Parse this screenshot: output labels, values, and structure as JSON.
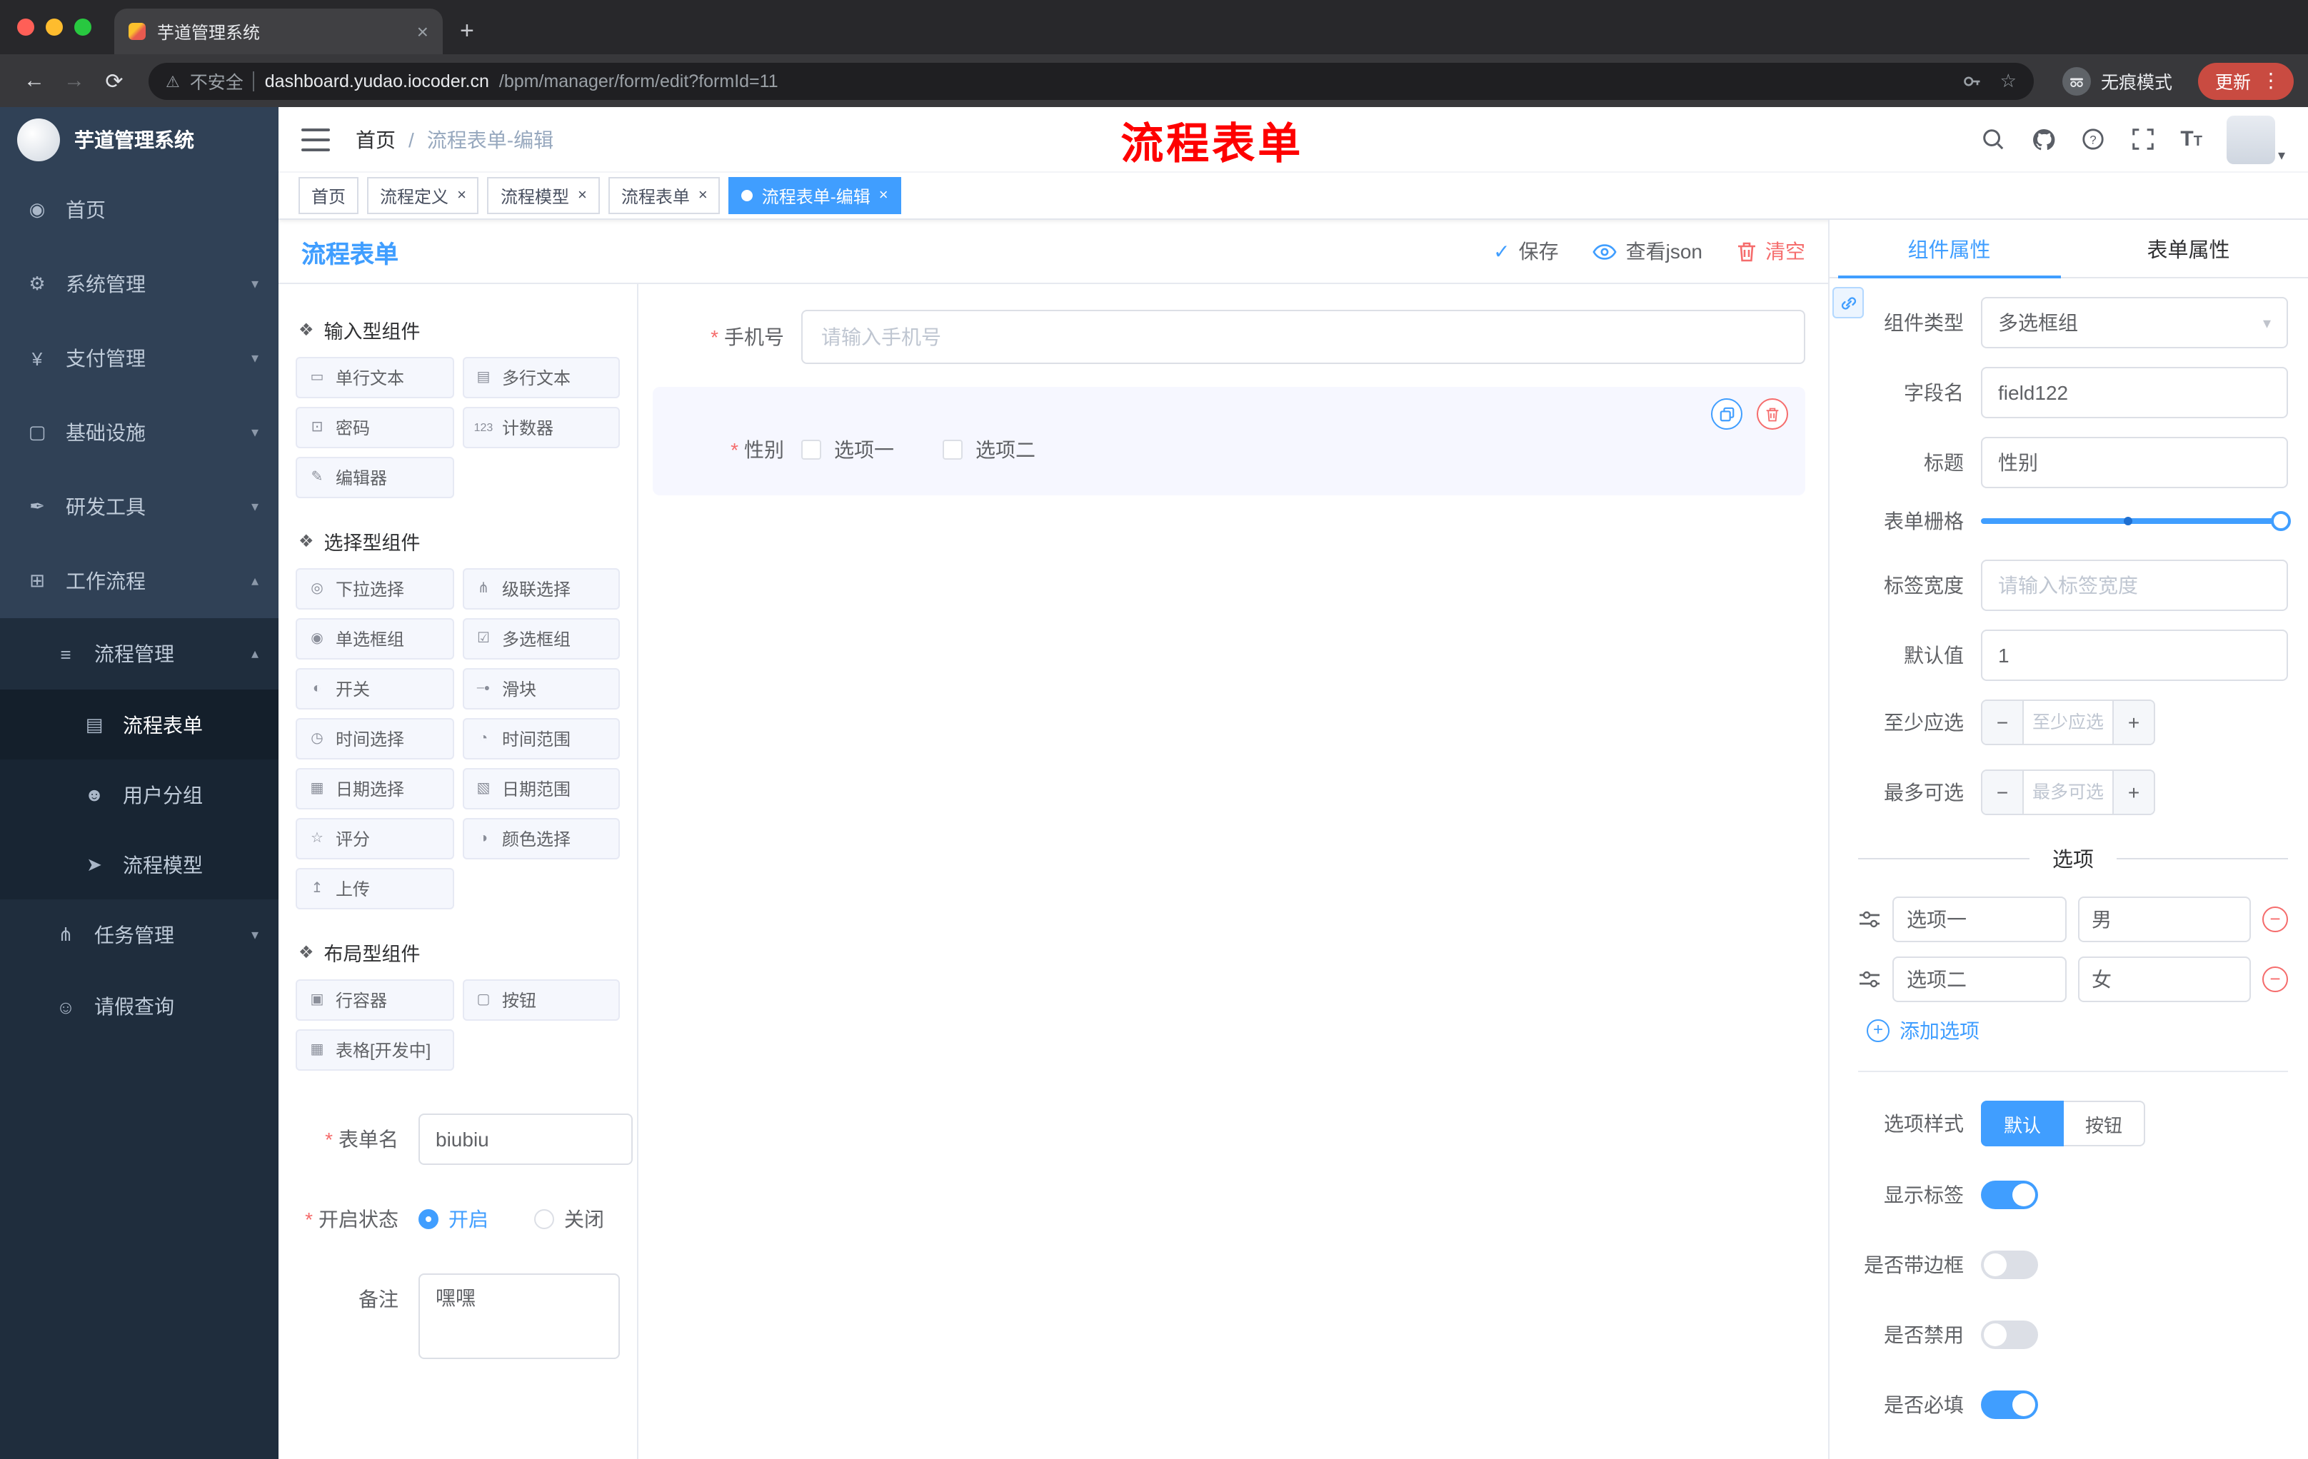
{
  "browser": {
    "tab_title": "芋道管理系统",
    "security_label": "不安全",
    "url_host": "dashboard.yudao.iocoder.cn",
    "url_path": "/bpm/manager/form/edit?formId=11",
    "incognito_label": "无痕模式",
    "update_label": "更新"
  },
  "sidebar": {
    "logo_title": "芋道管理系统",
    "items": [
      {
        "label": "首页",
        "icon": "◉"
      },
      {
        "label": "系统管理",
        "icon": "⚙"
      },
      {
        "label": "支付管理",
        "icon": "¥"
      },
      {
        "label": "基础设施",
        "icon": "▢"
      },
      {
        "label": "研发工具",
        "icon": "✒"
      },
      {
        "label": "工作流程",
        "icon": "⊞"
      },
      {
        "label": "流程管理",
        "icon": "≡"
      },
      {
        "label": "流程表单",
        "icon": "▤"
      },
      {
        "label": "用户分组",
        "icon": "☻"
      },
      {
        "label": "流程模型",
        "icon": "➤"
      },
      {
        "label": "任务管理",
        "icon": "⋔"
      },
      {
        "label": "请假查询",
        "icon": "☺"
      }
    ]
  },
  "header": {
    "breadcrumb_home": "首页",
    "breadcrumb_current": "流程表单-编辑",
    "annotation": "流程表单"
  },
  "tags": {
    "items": [
      {
        "label": "首页"
      },
      {
        "label": "流程定义"
      },
      {
        "label": "流程模型"
      },
      {
        "label": "流程表单"
      },
      {
        "label": "流程表单-编辑"
      }
    ]
  },
  "designer": {
    "title": "流程表单",
    "save_label": "保存",
    "view_json_label": "查看json",
    "clear_label": "清空",
    "palette": [
      {
        "title": "输入型组件",
        "items": [
          {
            "label": "单行文本",
            "icon": "▭"
          },
          {
            "label": "多行文本",
            "icon": "▤"
          },
          {
            "label": "密码",
            "icon": "⊡"
          },
          {
            "label": "计数器",
            "icon": "123"
          },
          {
            "label": "编辑器",
            "icon": "✎"
          }
        ]
      },
      {
        "title": "选择型组件",
        "items": [
          {
            "label": "下拉选择",
            "icon": "◎"
          },
          {
            "label": "级联选择",
            "icon": "⋔"
          },
          {
            "label": "单选框组",
            "icon": "◉"
          },
          {
            "label": "多选框组",
            "icon": "☑"
          },
          {
            "label": "开关",
            "icon": "◐"
          },
          {
            "label": "滑块",
            "icon": "─●"
          },
          {
            "label": "时间选择",
            "icon": "◷"
          },
          {
            "label": "时间范围",
            "icon": "◔"
          },
          {
            "label": "日期选择",
            "icon": "▦"
          },
          {
            "label": "日期范围",
            "icon": "▧"
          },
          {
            "label": "评分",
            "icon": "☆"
          },
          {
            "label": "颜色选择",
            "icon": "◑"
          },
          {
            "label": "上传",
            "icon": "↥"
          }
        ]
      },
      {
        "title": "布局型组件",
        "items": [
          {
            "label": "行容器",
            "icon": "▣"
          },
          {
            "label": "按钮",
            "icon": "▢"
          },
          {
            "label": "表格[开发中]",
            "icon": "▦"
          }
        ]
      }
    ],
    "meta": {
      "form_name_label": "表单名",
      "form_name_value": "biubiu",
      "status_label": "开启状态",
      "status_on": "开启",
      "status_off": "关闭",
      "remark_label": "备注",
      "remark_value": "嘿嘿"
    },
    "canvas": {
      "phone_label": "手机号",
      "phone_placeholder": "请输入手机号",
      "gender_label": "性别",
      "gender_option1": "选项一",
      "gender_option2": "选项二"
    }
  },
  "props": {
    "tab_component": "组件属性",
    "tab_form": "表单属性",
    "rows": {
      "component_type_label": "组件类型",
      "component_type_value": "多选框组",
      "field_name_label": "字段名",
      "field_name_value": "field122",
      "title_label": "标题",
      "title_value": "性别",
      "grid_label": "表单栅格",
      "label_width_label": "标签宽度",
      "label_width_placeholder": "请输入标签宽度",
      "default_label": "默认值",
      "default_value": "1",
      "min_label": "至少应选",
      "min_placeholder": "至少应选",
      "max_label": "最多可选",
      "max_placeholder": "最多可选"
    },
    "options_title": "选项",
    "options": [
      {
        "label": "选项一",
        "value": "男"
      },
      {
        "label": "选项二",
        "value": "女"
      }
    ],
    "add_option_label": "添加选项",
    "option_style_label": "选项样式",
    "option_style_default": "默认",
    "option_style_button": "按钮",
    "toggle_show_label": "显示标签",
    "toggle_border_label": "是否带边框",
    "toggle_disabled_label": "是否禁用",
    "toggle_required_label": "是否必填"
  },
  "colors": {
    "primary": "#409eff",
    "danger": "#f56c6c",
    "annotation_red": "#fe0000",
    "sidebar_bg": "#304156",
    "sidebar_sub_bg": "#1f2d3d"
  }
}
